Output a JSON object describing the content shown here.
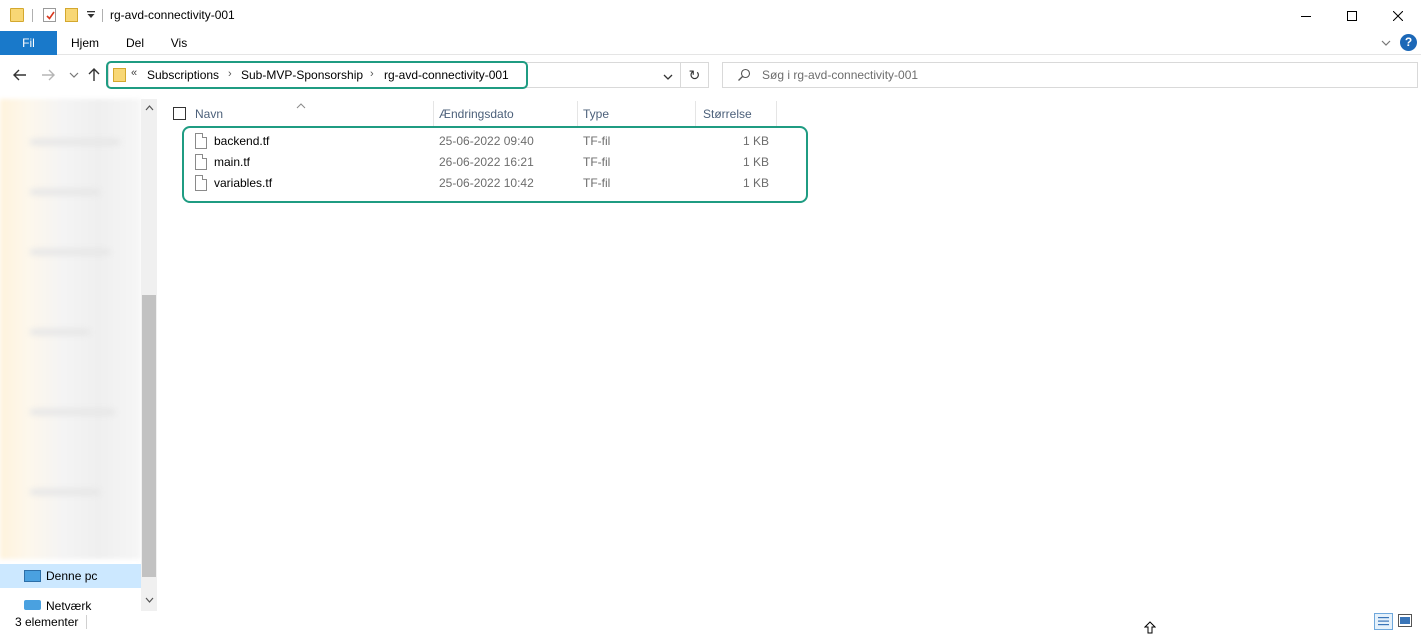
{
  "window": {
    "title": "rg-avd-connectivity-001"
  },
  "ribbon": {
    "tabs": [
      "Fil",
      "Hjem",
      "Del",
      "Vis"
    ],
    "help_label": "?"
  },
  "address": {
    "overflow": "«",
    "crumbs": [
      "Subscriptions",
      "Sub-MVP-Sponsorship",
      "rg-avd-connectivity-001"
    ],
    "refresh_glyph": "↻"
  },
  "search": {
    "placeholder": "Søg i rg-avd-connectivity-001"
  },
  "columns": {
    "name": "Navn",
    "date": "Ændringsdato",
    "type": "Type",
    "size": "Størrelse"
  },
  "files": [
    {
      "name": "backend.tf",
      "date": "25-06-2022 09:40",
      "type": "TF-fil",
      "size": "1 KB"
    },
    {
      "name": "main.tf",
      "date": "26-06-2022 16:21",
      "type": "TF-fil",
      "size": "1 KB"
    },
    {
      "name": "variables.tf",
      "date": "25-06-2022 10:42",
      "type": "TF-fil",
      "size": "1 KB"
    }
  ],
  "navpane": {
    "this_pc": "Denne pc",
    "network": "Netværk"
  },
  "status": {
    "item_count": "3 elementer"
  },
  "colors": {
    "accent": "#1979ca",
    "highlight": "#1f9c82",
    "selected_nav": "#cce8ff"
  }
}
